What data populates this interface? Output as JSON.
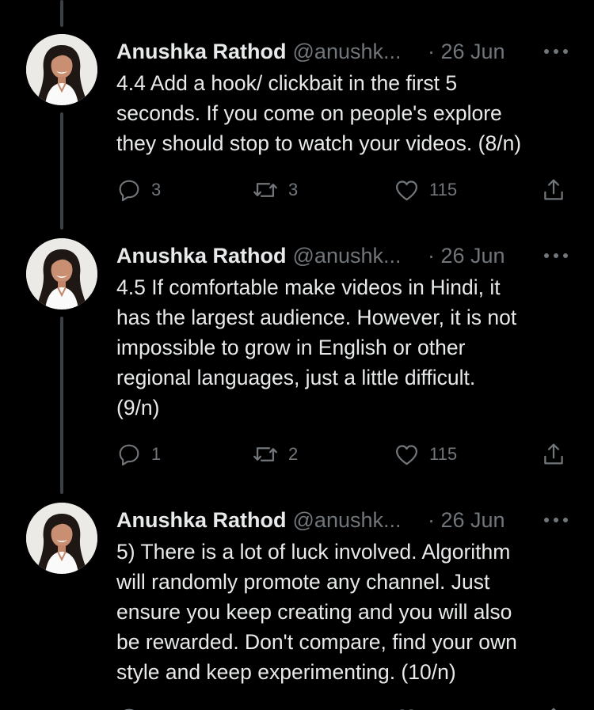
{
  "tweets": [
    {
      "name": "Anushka Rathod",
      "handle": "@anushk...",
      "date": "· 26 Jun",
      "text": "4.4 Add a hook/ clickbait in the first 5\nseconds. If you come on people's explore\nthey should stop to watch your videos. (8/n)",
      "replies": "3",
      "retweets": "3",
      "likes": "115"
    },
    {
      "name": "Anushka Rathod",
      "handle": "@anushk...",
      "date": "· 26 Jun",
      "text": "4.5 If comfortable make videos in Hindi, it\nhas the largest audience. However, it is not\nimpossible to grow in English or other\nregional languages, just a little difficult.\n(9/n)",
      "replies": "1",
      "retweets": "2",
      "likes": "115"
    },
    {
      "name": "Anushka Rathod",
      "handle": "@anushk...",
      "date": "· 26 Jun",
      "text": "5) There is a lot of luck involved. Algorithm\nwill randomly promote any channel. Just\nensure you keep creating and you will also\nbe rewarded. Don't compare, find your own\nstyle and keep experimenting.  (10/n)"
    }
  ],
  "icons": {
    "reply": "reply-icon",
    "retweet": "retweet-icon",
    "like": "heart-icon",
    "share": "share-icon",
    "more": "more-icon"
  },
  "colors": {
    "background": "#000000",
    "text": "#e7e9ea",
    "muted": "#71767b",
    "thread_line": "#3d4146"
  }
}
